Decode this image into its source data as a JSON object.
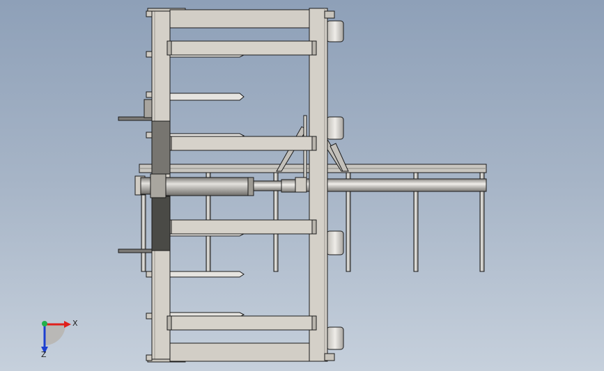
{
  "triad": {
    "x_label": "X",
    "z_label": "Z",
    "x_color": "#e0201c",
    "y_color": "#22b14c",
    "z_color": "#1c3fd0"
  },
  "colors": {
    "background_top": "#8ea0b8",
    "background_bottom": "#c6d0dc",
    "steel_light": "#d0ccc4",
    "steel_shadow": "#8b8780",
    "steel_dark": "#4a4a46",
    "outline": "#1a1a1a"
  }
}
